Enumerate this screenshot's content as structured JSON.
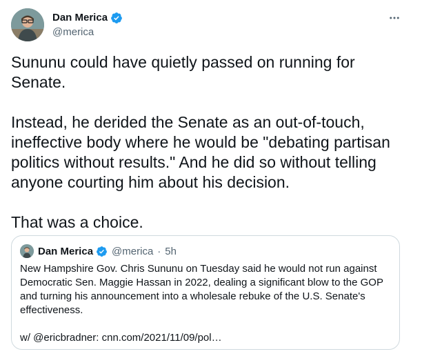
{
  "author": {
    "name": "Dan Merica",
    "handle": "@merica",
    "verified": true
  },
  "tweet": {
    "text": "Sununu could have quietly passed on running for\nSenate.\n\nInstead, he derided the Senate as an out-of-touch,\nineffective body where he would be \"debating partisan\npolitics without results.\" And he did so without telling\nanyone courting him about his decision.\n\nThat was a choice."
  },
  "quote": {
    "name": "Dan Merica",
    "handle": "@merica",
    "separator": "·",
    "time": "5h",
    "text": "New Hampshire Gov. Chris Sununu on Tuesday said he would not run against\nDemocratic Sen. Maggie Hassan in 2022, dealing a significant blow to the GOP\nand turning his announcement into a wholesale rebuke of the U.S. Senate's\neffectiveness.\n\nw/ @ericbradner: cnn.com/2021/11/09/pol…"
  },
  "colors": {
    "text": "#0f1419",
    "secondary": "#536471",
    "verified": "#1d9bf0",
    "border": "#cfd9de"
  },
  "icons": {
    "more": "more-horizontal-icon",
    "verified": "verified-badge-icon"
  }
}
